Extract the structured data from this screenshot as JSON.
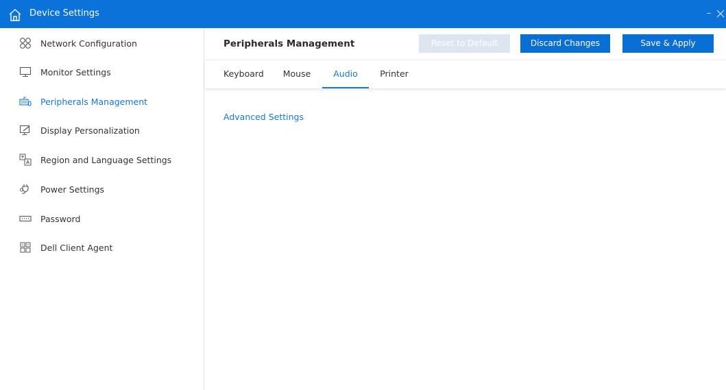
{
  "window": {
    "title": "Device Settings",
    "minimize_glyph": "–",
    "icons": {
      "home": "home-icon",
      "close": "close-icon"
    },
    "accent_color": "#0a72d8"
  },
  "sidebar": {
    "items": [
      {
        "label": "Network Configuration",
        "icon": "network-icon"
      },
      {
        "label": "Monitor Settings",
        "icon": "monitor-icon"
      },
      {
        "label": "Peripherals Management",
        "icon": "keyboard-mouse-icon",
        "active": true
      },
      {
        "label": "Display Personalization",
        "icon": "display-personalization-icon"
      },
      {
        "label": "Region and Language Settings",
        "icon": "language-icon"
      },
      {
        "label": "Power Settings",
        "icon": "power-plug-icon"
      },
      {
        "label": "Password",
        "icon": "password-icon"
      },
      {
        "label": "Dell Client Agent",
        "icon": "client-agent-icon"
      }
    ]
  },
  "main": {
    "title": "Peripherals Management",
    "buttons": {
      "reset": "Reset to Default",
      "discard": "Discard Changes",
      "save": "Save & Apply"
    },
    "tabs": [
      {
        "label": "Keyboard"
      },
      {
        "label": "Mouse"
      },
      {
        "label": "Audio",
        "active": true
      },
      {
        "label": "Printer"
      }
    ],
    "advanced_link": "Advanced Settings"
  }
}
